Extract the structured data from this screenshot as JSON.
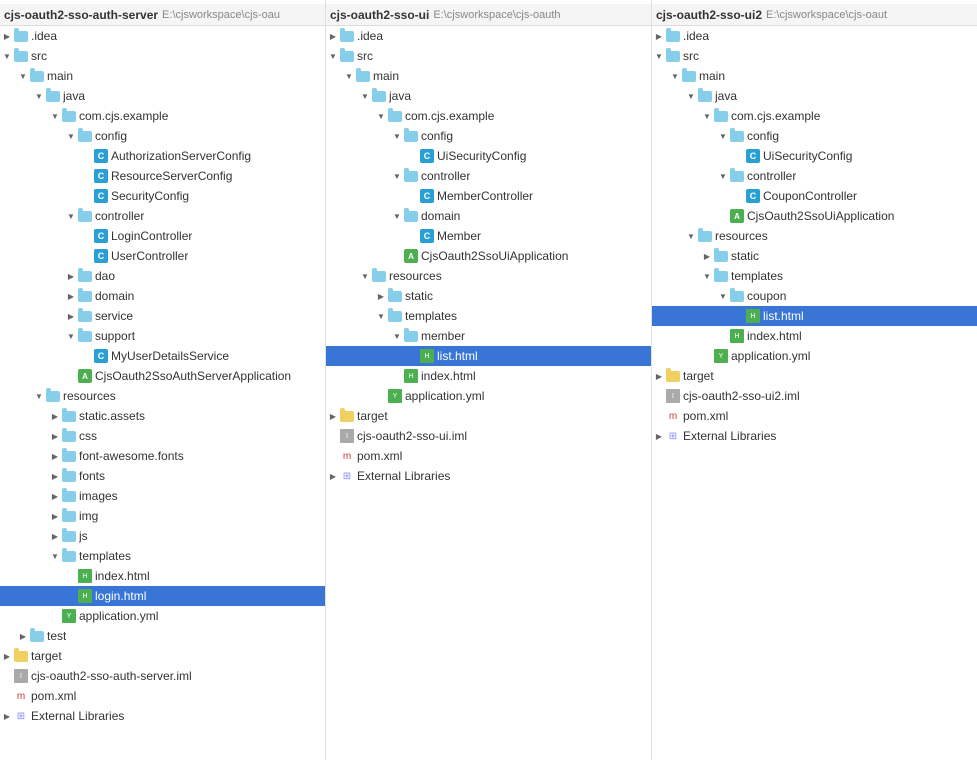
{
  "panels": [
    {
      "id": "panel1",
      "title": "cjs-oauth2-sso-auth-server",
      "path": "E:\\cjsworkspace\\cjs-oau",
      "nodes": [
        {
          "id": "n1",
          "label": ".idea",
          "type": "folder",
          "depth": 1,
          "arrow": "closed"
        },
        {
          "id": "n2",
          "label": "src",
          "type": "folder",
          "depth": 1,
          "arrow": "open"
        },
        {
          "id": "n3",
          "label": "main",
          "type": "folder",
          "depth": 2,
          "arrow": "open"
        },
        {
          "id": "n4",
          "label": "java",
          "type": "folder-java",
          "depth": 3,
          "arrow": "open"
        },
        {
          "id": "n5",
          "label": "com.cjs.example",
          "type": "package",
          "depth": 4,
          "arrow": "open"
        },
        {
          "id": "n6",
          "label": "config",
          "type": "folder",
          "depth": 5,
          "arrow": "open"
        },
        {
          "id": "n7",
          "label": "AuthorizationServerConfig",
          "type": "class",
          "depth": 6,
          "arrow": "none"
        },
        {
          "id": "n8",
          "label": "ResourceServerConfig",
          "type": "class",
          "depth": 6,
          "arrow": "none"
        },
        {
          "id": "n9",
          "label": "SecurityConfig",
          "type": "class",
          "depth": 6,
          "arrow": "none"
        },
        {
          "id": "n10",
          "label": "controller",
          "type": "folder",
          "depth": 5,
          "arrow": "open"
        },
        {
          "id": "n11",
          "label": "LoginController",
          "type": "class",
          "depth": 6,
          "arrow": "none"
        },
        {
          "id": "n12",
          "label": "UserController",
          "type": "class",
          "depth": 6,
          "arrow": "none"
        },
        {
          "id": "n13",
          "label": "dao",
          "type": "folder",
          "depth": 5,
          "arrow": "closed"
        },
        {
          "id": "n14",
          "label": "domain",
          "type": "folder",
          "depth": 5,
          "arrow": "closed"
        },
        {
          "id": "n15",
          "label": "service",
          "type": "folder",
          "depth": 5,
          "arrow": "closed"
        },
        {
          "id": "n16",
          "label": "support",
          "type": "folder",
          "depth": 5,
          "arrow": "open"
        },
        {
          "id": "n17",
          "label": "MyUserDetailsService",
          "type": "class",
          "depth": 6,
          "arrow": "none"
        },
        {
          "id": "n18",
          "label": "CjsOauth2SsoAuthServerApplication",
          "type": "class-small",
          "depth": 5,
          "arrow": "none"
        },
        {
          "id": "n19",
          "label": "resources",
          "type": "folder",
          "depth": 3,
          "arrow": "open"
        },
        {
          "id": "n20",
          "label": "static.assets",
          "type": "folder",
          "depth": 4,
          "arrow": "closed"
        },
        {
          "id": "n21",
          "label": "css",
          "type": "folder",
          "depth": 4,
          "arrow": "closed"
        },
        {
          "id": "n22",
          "label": "font-awesome.fonts",
          "type": "folder",
          "depth": 4,
          "arrow": "closed"
        },
        {
          "id": "n23",
          "label": "fonts",
          "type": "folder",
          "depth": 4,
          "arrow": "closed"
        },
        {
          "id": "n24",
          "label": "images",
          "type": "folder",
          "depth": 4,
          "arrow": "closed"
        },
        {
          "id": "n25",
          "label": "img",
          "type": "folder",
          "depth": 4,
          "arrow": "closed"
        },
        {
          "id": "n26",
          "label": "js",
          "type": "folder",
          "depth": 4,
          "arrow": "closed"
        },
        {
          "id": "n27",
          "label": "templates",
          "type": "folder",
          "depth": 4,
          "arrow": "open"
        },
        {
          "id": "n28",
          "label": "index.html",
          "type": "html-green",
          "depth": 5,
          "arrow": "none"
        },
        {
          "id": "n29",
          "label": "login.html",
          "type": "html-green",
          "depth": 5,
          "arrow": "none",
          "selected": true
        },
        {
          "id": "n30",
          "label": "application.yml",
          "type": "yaml",
          "depth": 4,
          "arrow": "none"
        },
        {
          "id": "n31",
          "label": "test",
          "type": "folder",
          "depth": 2,
          "arrow": "closed"
        },
        {
          "id": "n32",
          "label": "target",
          "type": "folder-yellow",
          "depth": 1,
          "arrow": "closed"
        },
        {
          "id": "n33",
          "label": "cjs-oauth2-sso-auth-server.iml",
          "type": "iml",
          "depth": 1,
          "arrow": "none"
        },
        {
          "id": "n34",
          "label": "pom.xml",
          "type": "pom",
          "depth": 1,
          "arrow": "none"
        },
        {
          "id": "n35",
          "label": "External Libraries",
          "type": "extlib",
          "depth": 1,
          "arrow": "closed"
        }
      ]
    },
    {
      "id": "panel2",
      "title": "cjs-oauth2-sso-ui",
      "path": "E:\\cjsworkspace\\cjs-oauth",
      "nodes": [
        {
          "id": "m1",
          "label": ".idea",
          "type": "folder",
          "depth": 1,
          "arrow": "closed"
        },
        {
          "id": "m2",
          "label": "src",
          "type": "folder",
          "depth": 1,
          "arrow": "open"
        },
        {
          "id": "m3",
          "label": "main",
          "type": "folder",
          "depth": 2,
          "arrow": "open"
        },
        {
          "id": "m4",
          "label": "java",
          "type": "folder-java",
          "depth": 3,
          "arrow": "open"
        },
        {
          "id": "m5",
          "label": "com.cjs.example",
          "type": "package",
          "depth": 4,
          "arrow": "open"
        },
        {
          "id": "m6",
          "label": "config",
          "type": "folder",
          "depth": 5,
          "arrow": "open"
        },
        {
          "id": "m7",
          "label": "UiSecurityConfig",
          "type": "class",
          "depth": 6,
          "arrow": "none"
        },
        {
          "id": "m8",
          "label": "controller",
          "type": "folder",
          "depth": 5,
          "arrow": "open"
        },
        {
          "id": "m9",
          "label": "MemberController",
          "type": "class",
          "depth": 6,
          "arrow": "none"
        },
        {
          "id": "m10",
          "label": "domain",
          "type": "folder",
          "depth": 5,
          "arrow": "open"
        },
        {
          "id": "m11",
          "label": "Member",
          "type": "class",
          "depth": 6,
          "arrow": "none"
        },
        {
          "id": "m12",
          "label": "CjsOauth2SsoUiApplication",
          "type": "class-small",
          "depth": 5,
          "arrow": "none"
        },
        {
          "id": "m13",
          "label": "resources",
          "type": "folder",
          "depth": 3,
          "arrow": "open"
        },
        {
          "id": "m14",
          "label": "static",
          "type": "folder",
          "depth": 4,
          "arrow": "closed"
        },
        {
          "id": "m15",
          "label": "templates",
          "type": "folder",
          "depth": 4,
          "arrow": "open"
        },
        {
          "id": "m16",
          "label": "member",
          "type": "folder",
          "depth": 5,
          "arrow": "open"
        },
        {
          "id": "m17",
          "label": "list.html",
          "type": "html-green",
          "depth": 6,
          "arrow": "none",
          "selected": true
        },
        {
          "id": "m18",
          "label": "index.html",
          "type": "html-green",
          "depth": 5,
          "arrow": "none"
        },
        {
          "id": "m19",
          "label": "application.yml",
          "type": "yaml",
          "depth": 4,
          "arrow": "none"
        },
        {
          "id": "m20",
          "label": "target",
          "type": "folder-yellow",
          "depth": 1,
          "arrow": "closed"
        },
        {
          "id": "m21",
          "label": "cjs-oauth2-sso-ui.iml",
          "type": "iml",
          "depth": 1,
          "arrow": "none"
        },
        {
          "id": "m22",
          "label": "pom.xml",
          "type": "pom",
          "depth": 1,
          "arrow": "none"
        },
        {
          "id": "m23",
          "label": "External Libraries",
          "type": "extlib",
          "depth": 1,
          "arrow": "closed"
        }
      ]
    },
    {
      "id": "panel3",
      "title": "cjs-oauth2-sso-ui2",
      "path": "E:\\cjsworkspace\\cjs-oaut",
      "nodes": [
        {
          "id": "p1",
          "label": ".idea",
          "type": "folder",
          "depth": 1,
          "arrow": "closed"
        },
        {
          "id": "p2",
          "label": "src",
          "type": "folder",
          "depth": 1,
          "arrow": "open"
        },
        {
          "id": "p3",
          "label": "main",
          "type": "folder",
          "depth": 2,
          "arrow": "open"
        },
        {
          "id": "p4",
          "label": "java",
          "type": "folder-java",
          "depth": 3,
          "arrow": "open"
        },
        {
          "id": "p5",
          "label": "com.cjs.example",
          "type": "package",
          "depth": 4,
          "arrow": "open"
        },
        {
          "id": "p6",
          "label": "config",
          "type": "folder",
          "depth": 5,
          "arrow": "open"
        },
        {
          "id": "p7",
          "label": "UiSecurityConfig",
          "type": "class",
          "depth": 6,
          "arrow": "none"
        },
        {
          "id": "p8",
          "label": "controller",
          "type": "folder",
          "depth": 5,
          "arrow": "open"
        },
        {
          "id": "p9",
          "label": "CouponController",
          "type": "class",
          "depth": 6,
          "arrow": "none"
        },
        {
          "id": "p10",
          "label": "CjsOauth2SsoUiApplication",
          "type": "class-small",
          "depth": 5,
          "arrow": "none"
        },
        {
          "id": "p11",
          "label": "resources",
          "type": "folder",
          "depth": 3,
          "arrow": "open"
        },
        {
          "id": "p12",
          "label": "static",
          "type": "folder",
          "depth": 4,
          "arrow": "closed"
        },
        {
          "id": "p13",
          "label": "templates",
          "type": "folder",
          "depth": 4,
          "arrow": "open"
        },
        {
          "id": "p14",
          "label": "coupon",
          "type": "folder",
          "depth": 5,
          "arrow": "open"
        },
        {
          "id": "p15",
          "label": "list.html",
          "type": "html-green",
          "depth": 6,
          "arrow": "none",
          "selected": true
        },
        {
          "id": "p16",
          "label": "index.html",
          "type": "html-green",
          "depth": 5,
          "arrow": "none"
        },
        {
          "id": "p17",
          "label": "application.yml",
          "type": "yaml",
          "depth": 4,
          "arrow": "none"
        },
        {
          "id": "p18",
          "label": "target",
          "type": "folder-yellow",
          "depth": 1,
          "arrow": "closed"
        },
        {
          "id": "p19",
          "label": "cjs-oauth2-sso-ui2.iml",
          "type": "iml",
          "depth": 1,
          "arrow": "none"
        },
        {
          "id": "p20",
          "label": "pom.xml",
          "type": "pom",
          "depth": 1,
          "arrow": "none"
        },
        {
          "id": "p21",
          "label": "External Libraries",
          "type": "extlib",
          "depth": 1,
          "arrow": "closed"
        }
      ]
    }
  ]
}
